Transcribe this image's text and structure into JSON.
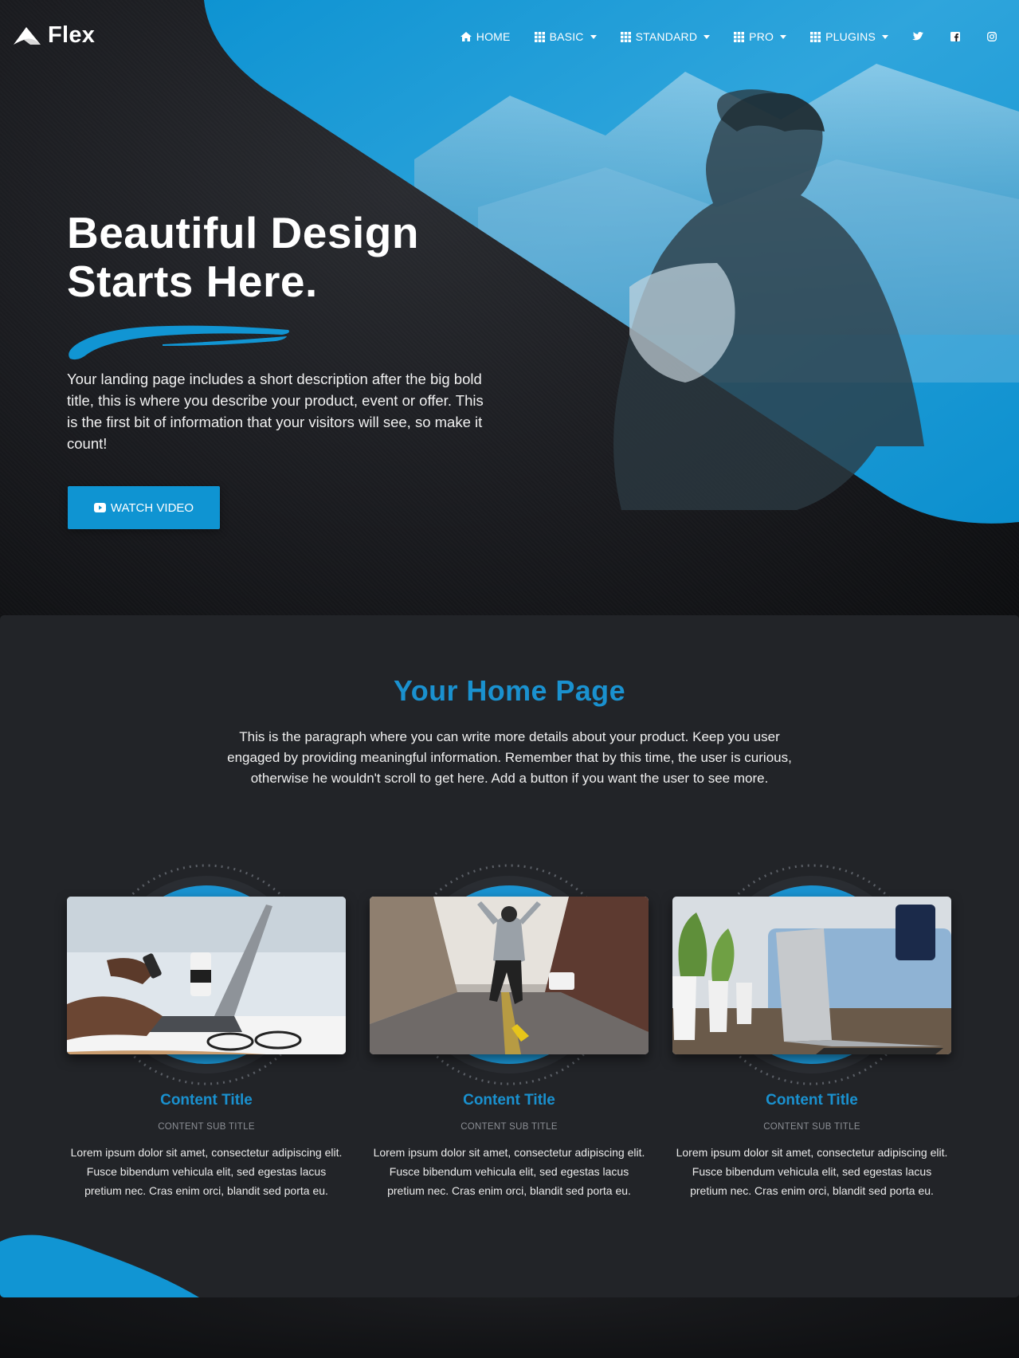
{
  "brand": {
    "name": "Flex",
    "logo_icon": "paper-plane-logo-icon"
  },
  "nav": {
    "items": [
      {
        "label": "HOME",
        "icon": "home-icon",
        "dropdown": false
      },
      {
        "label": "BASIC",
        "icon": "grid-icon",
        "dropdown": true
      },
      {
        "label": "STANDARD",
        "icon": "grid-icon",
        "dropdown": true
      },
      {
        "label": "PRO",
        "icon": "grid-icon",
        "dropdown": true
      },
      {
        "label": "PLUGINS",
        "icon": "grid-icon",
        "dropdown": true
      }
    ],
    "social": [
      "twitter-icon",
      "facebook-icon",
      "instagram-icon"
    ]
  },
  "hero": {
    "title_line1": "Beautiful Design",
    "title_line2": "Starts Here.",
    "description": "Your landing page includes a short description after the big bold title, this is where you describe your product, event or offer. This is the first bit of information that your visitors will see, so make it count!",
    "button_label": "WATCH VIDEO",
    "button_icon": "youtube-play-icon"
  },
  "main": {
    "title": "Your Home Page",
    "description": "This is the paragraph where you can write more details about your product. Keep you user engaged by providing meaningful information. Remember that by this time, the user is curious, otherwise he wouldn't scroll to get here. Add a button if you want the user to see more.",
    "cards": [
      {
        "title": "Content Title",
        "subtitle": "CONTENT SUB TITLE",
        "text": "Lorem ipsum dolor sit amet, consectetur adipiscing elit. Fusce bibendum vehicula elit, sed egestas lacus pretium nec. Cras enim orci, blandit sed porta eu.",
        "image": "laptop-phone-coffee-photo"
      },
      {
        "title": "Content Title",
        "subtitle": "CONTENT SUB TITLE",
        "text": "Lorem ipsum dolor sit amet, consectetur adipiscing elit. Fusce bibendum vehicula elit, sed egestas lacus pretium nec. Cras enim orci, blandit sed porta eu.",
        "image": "street-dancer-photo"
      },
      {
        "title": "Content Title",
        "subtitle": "CONTENT SUB TITLE",
        "text": "Lorem ipsum dolor sit amet, consectetur adipiscing elit. Fusce bibendum vehicula elit, sed egestas lacus pretium nec. Cras enim orci, blandit sed porta eu.",
        "image": "laptop-plants-sofa-photo"
      }
    ]
  },
  "colors": {
    "accent": "#0f94d2",
    "title_blue": "#1a91cf",
    "section_bg": "#222428",
    "hero_bg": "#1a1b1f"
  }
}
